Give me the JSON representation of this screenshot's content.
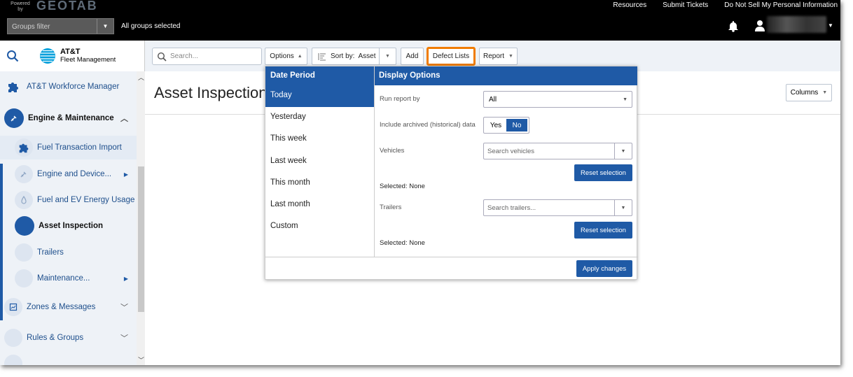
{
  "topbar": {
    "powered_by": "Powered by",
    "brand": "GEOTAB",
    "links": [
      "Resources",
      "Submit Tickets",
      "Do Not Sell My Personal Information"
    ],
    "groups_filter_placeholder": "Groups filter",
    "all_groups": "All groups selected"
  },
  "sidebar": {
    "brand_line1": "AT&T",
    "brand_line2": "Fleet Management",
    "items": [
      {
        "label": "AT&T Workforce Manager"
      },
      {
        "label": "Engine & Maintenance"
      },
      {
        "label": "Fuel Transaction Import"
      },
      {
        "label": "Engine and Device..."
      },
      {
        "label": "Fuel and EV Energy Usage"
      },
      {
        "label": "Asset Inspection"
      },
      {
        "label": "Trailers"
      },
      {
        "label": "Maintenance..."
      },
      {
        "label": "Zones & Messages"
      },
      {
        "label": "Rules & Groups"
      }
    ]
  },
  "toolbar": {
    "search_placeholder": "Search...",
    "options_label": "Options",
    "sort_by_label": "Sort by:",
    "sort_by_value": "Asset",
    "add_label": "Add",
    "defect_lists_label": "Defect Lists",
    "report_label": "Report"
  },
  "page": {
    "title": "Asset Inspection",
    "columns_label": "Columns"
  },
  "popup": {
    "date_period_title": "Date Period",
    "date_periods": [
      "Today",
      "Yesterday",
      "This week",
      "Last week",
      "This month",
      "Last month",
      "Custom"
    ],
    "selected_period": "Today",
    "display_options_title": "Display Options",
    "run_report_by_label": "Run report by",
    "run_report_by_value": "All",
    "archived_label": "Include archived (historical) data",
    "yes_label": "Yes",
    "no_label": "No",
    "vehicles_label": "Vehicles",
    "vehicles_placeholder": "Search vehicles",
    "reset_vehicles_label": "Reset selection",
    "vehicles_selected": "Selected: None",
    "trailers_label": "Trailers",
    "trailers_placeholder": "Search trailers...",
    "reset_trailers_label": "Reset selection",
    "trailers_selected": "Selected: None",
    "apply_label": "Apply changes"
  },
  "colors": {
    "accent_blue": "#1f5aa6",
    "highlight_orange": "#f07c00",
    "topbar_black": "#000000"
  }
}
